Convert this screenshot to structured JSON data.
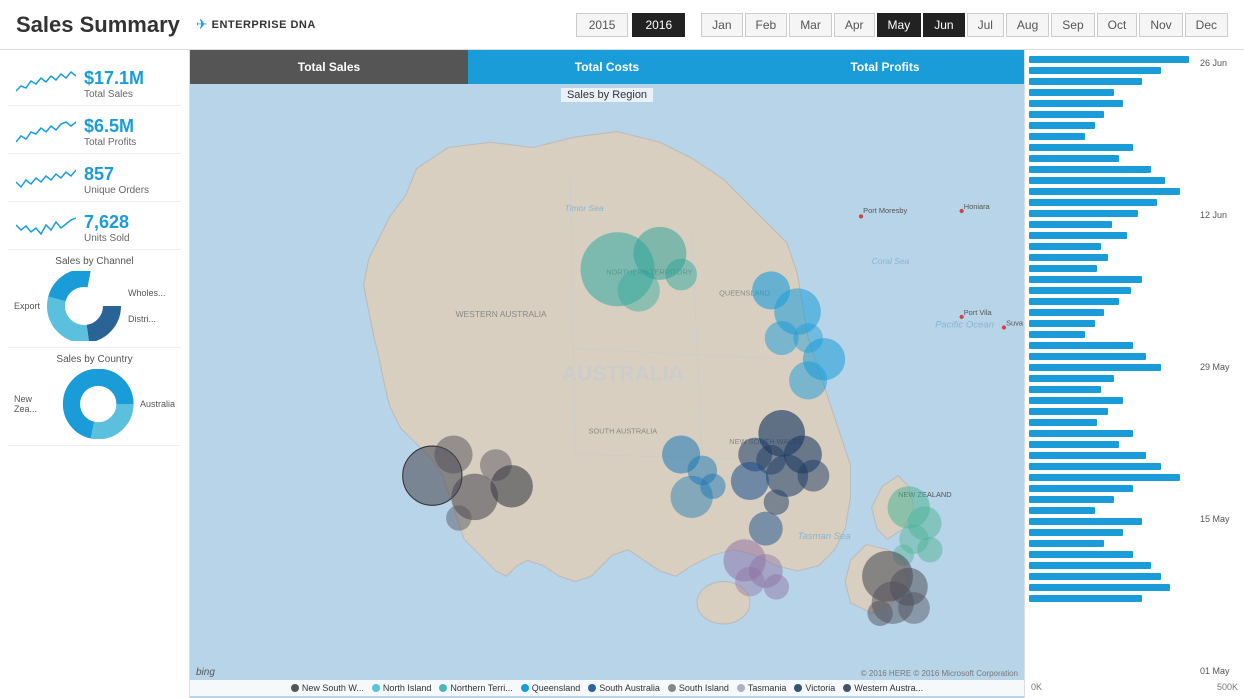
{
  "header": {
    "title": "Sales Summary",
    "brand": "ENTERPRISE DNA",
    "years": [
      "2015",
      "2016"
    ],
    "active_year": "2016",
    "months": [
      "Jan",
      "Feb",
      "Mar",
      "Apr",
      "May",
      "Jun",
      "Jul",
      "Aug",
      "Sep",
      "Oct",
      "Nov",
      "Dec"
    ],
    "active_months": [
      "May",
      "Jun"
    ]
  },
  "metrics": [
    {
      "value": "$17.1M",
      "label": "Total Sales"
    },
    {
      "value": "$6.5M",
      "label": "Total Profits"
    },
    {
      "value": "857",
      "label": "Unique Orders"
    },
    {
      "value": "7,628",
      "label": "Units Sold"
    }
  ],
  "channels": {
    "title": "Sales by Channel",
    "labels": [
      "Export",
      "Distri...",
      "Wholes..."
    ],
    "colors": [
      "#2a6496",
      "#5bc0de",
      "#1a9cd8"
    ]
  },
  "countries": {
    "title": "Sales by Country",
    "labels": [
      "New Zea...",
      "Australia"
    ],
    "colors": [
      "#5bc0de",
      "#1a9cd8"
    ]
  },
  "tabs": [
    {
      "label": "Total Sales",
      "type": "sales"
    },
    {
      "label": "Total Costs",
      "type": "costs"
    },
    {
      "label": "Total Profits",
      "type": "profits"
    }
  ],
  "map": {
    "title": "Sales by Region",
    "bing": "bing",
    "copyright": "© 2016 HERE  © 2016 Microsoft Corporation"
  },
  "legend": [
    {
      "label": "New South W...",
      "color": "#555"
    },
    {
      "label": "North Island",
      "color": "#5bc0de"
    },
    {
      "label": "Northern Terri...",
      "color": "#4ab8b8"
    },
    {
      "label": "Queensland",
      "color": "#1a9cd8"
    },
    {
      "label": "South Australia",
      "color": "#2a6496"
    },
    {
      "label": "South Island",
      "color": "#888"
    },
    {
      "label": "Tasmania",
      "color": "#b0b0c0"
    },
    {
      "label": "Victoria",
      "color": "#335577"
    },
    {
      "label": "Western Austra...",
      "color": "#445566"
    }
  ],
  "bar_chart": {
    "date_labels": [
      "26 Jun",
      "12 Jun",
      "29 May",
      "15 May",
      "01 May"
    ],
    "axis_labels": [
      "0K",
      "500K"
    ],
    "bars": [
      85,
      70,
      60,
      45,
      50,
      40,
      35,
      30,
      55,
      48,
      65,
      72,
      80,
      68,
      58,
      44,
      52,
      38,
      42,
      36,
      60,
      54,
      48,
      40,
      35,
      30,
      55,
      62,
      70,
      45,
      38,
      50,
      42,
      36,
      55,
      48,
      62,
      70,
      80,
      55,
      45,
      35,
      60,
      50,
      40,
      55,
      65,
      70,
      75,
      60
    ]
  }
}
